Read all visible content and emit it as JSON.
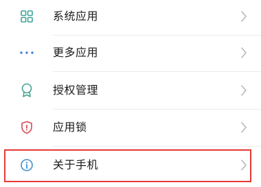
{
  "settings": {
    "items": [
      {
        "label": "系统应用",
        "icon": "grid-icon",
        "icon_color": "#3aa39a"
      },
      {
        "label": "更多应用",
        "icon": "more-dots-icon",
        "icon_color": "#3e7fd6"
      },
      {
        "label": "授权管理",
        "icon": "badge-icon",
        "icon_color": "#46a392"
      },
      {
        "label": "应用锁",
        "icon": "shield-icon",
        "icon_color": "#d44a56"
      },
      {
        "label": "关于手机",
        "icon": "info-icon",
        "icon_color": "#3b8fd0"
      }
    ],
    "highlight_color": "#e53935",
    "chevron_color": "#b5b5b5"
  }
}
